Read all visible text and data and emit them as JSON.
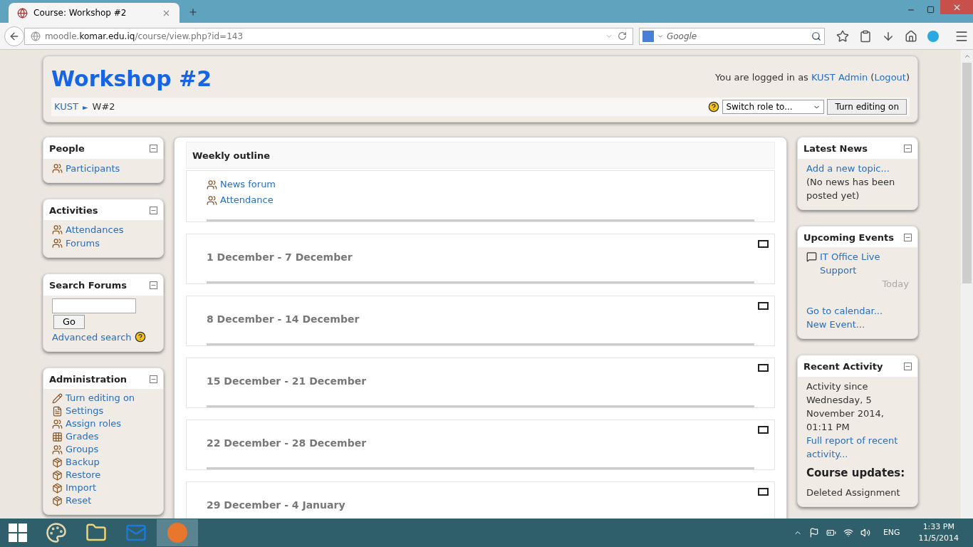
{
  "browser": {
    "tab_title": "Course: Workshop #2",
    "url_prefix": "moodle.",
    "url_host": "komar.edu.iq",
    "url_path": "/course/view.php?id=143",
    "search_placeholder": "Google"
  },
  "header": {
    "title": "Workshop #2",
    "login_prefix": "You are logged in as",
    "user": "KUST Admin",
    "paren_open": "(",
    "logout": "Logout",
    "paren_close": ")",
    "breadcrumb": [
      "KUST",
      "W#2"
    ],
    "breadcrumb_separator": "►",
    "switch_role": "Switch role to...",
    "edit_button": "Turn editing on"
  },
  "left_blocks": [
    {
      "title": "People",
      "kind": "links",
      "items": [
        "Participants"
      ]
    },
    {
      "title": "Activities",
      "kind": "links",
      "items": [
        "Attendances",
        "Forums"
      ]
    },
    {
      "title": "Search Forums",
      "kind": "search",
      "button": "Go",
      "link": "Advanced search"
    },
    {
      "title": "Administration",
      "kind": "links",
      "items": [
        "Turn editing on",
        "Settings",
        "Assign roles",
        "Grades",
        "Groups",
        "Backup",
        "Restore",
        "Import",
        "Reset"
      ]
    }
  ],
  "main": {
    "title": "Weekly outline",
    "intro_items": [
      "News forum",
      "Attendance"
    ],
    "weeks": [
      "1 December - 7 December",
      "8 December - 14 December",
      "15 December - 21 December",
      "22 December - 28 December",
      "29 December - 4 January"
    ]
  },
  "right_blocks": [
    {
      "title": "Latest News",
      "kind": "news",
      "link": "Add a new topic...",
      "note": "(No news has been posted yet)"
    },
    {
      "title": "Upcoming Events",
      "kind": "events",
      "event": "IT Office Live Support",
      "when": "Today",
      "links": [
        "Go to calendar...",
        "New Event..."
      ]
    },
    {
      "title": "Recent Activity",
      "kind": "activity",
      "since": "Activity since Wednesday, 5 November 2014, 01:11 PM",
      "link": "Full report of recent activity...",
      "heading": "Course updates:",
      "update": "Deleted Assignment"
    }
  ],
  "taskbar": {
    "language": "ENG",
    "time": "1:33 PM",
    "date": "11/5/2014"
  }
}
